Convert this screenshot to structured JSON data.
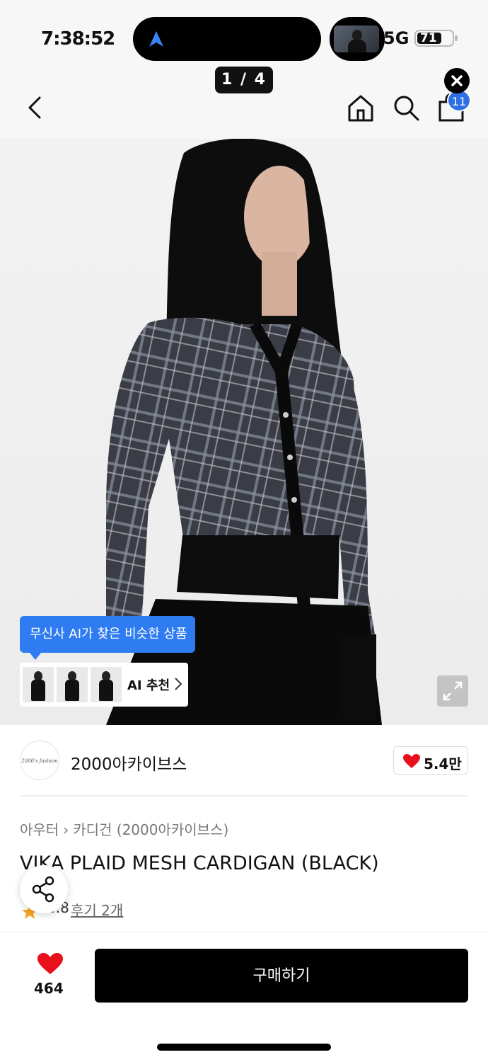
{
  "status_bar": {
    "time": "7:38:52",
    "network": "5G",
    "battery": "71"
  },
  "image_counter": "1 / 4",
  "header": {
    "cart_badge": "11"
  },
  "ai_recommend": {
    "banner_text": "무신사 AI가 찾은 비슷한 상품",
    "button_label": "AI 추천"
  },
  "brand": {
    "logo_text": "2000's fashion",
    "name": "2000아카이브스",
    "likes": "5.4만"
  },
  "breadcrumb": [
    "아우터",
    "카디건 (2000아카이브스)"
  ],
  "product": {
    "title": "VIKA PLAID MESH CARDIGAN (BLACK)",
    "rating": "4.8",
    "reviews": "후기 2개"
  },
  "bottom_bar": {
    "favorite_count": "464",
    "buy_label": "구매하기"
  },
  "colors": {
    "accent_blue": "#2f7bf1",
    "heart_red": "#e8111b",
    "star_yellow": "#f5a623"
  }
}
